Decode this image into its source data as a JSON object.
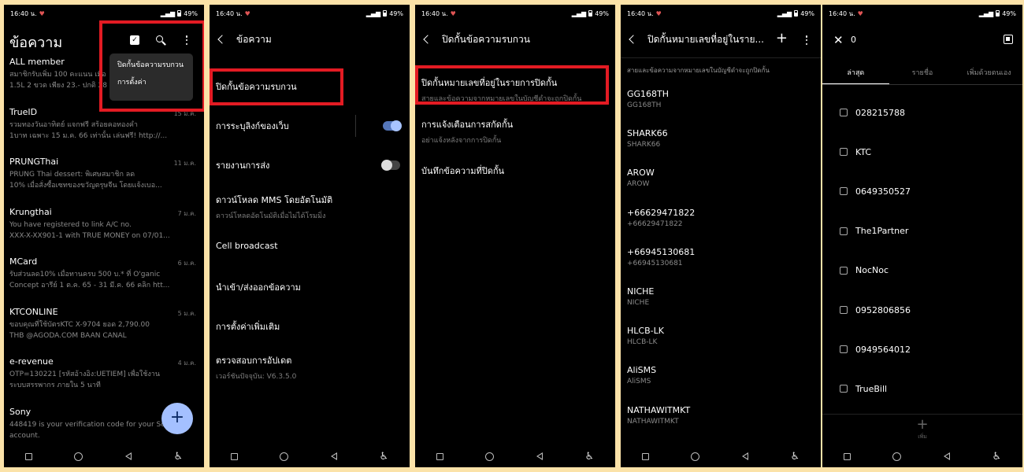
{
  "status": {
    "time": "16:40 น.",
    "battery": "49%"
  },
  "phone1": {
    "title": "ข้อความ",
    "menu": [
      "ปิดกั้นข้อความรบกวน",
      "การตั้งค่า"
    ],
    "messages": [
      {
        "name": "ALL member",
        "date": "",
        "line1": "สมาชิกรับเพิ่ม 100 คะแนน เมื่อ",
        "line2": "1.5L 2 ขวด เพียง 23.- ปกติ 28"
      },
      {
        "name": "TrueID",
        "date": "15 ม.ค.",
        "line1": "รวมทองวันอาทิตย์ แจกฟรี สร้อยคอทองคำ",
        "line2": "1บาท เฉพาะ 15 ม.ค. 66 เท่านั้น เล่นฟรี! http://..."
      },
      {
        "name": "PRUNGThai",
        "date": "11 ม.ค.",
        "line1": "PRUNG Thai dessert: พิเศษสมาชิก ลด",
        "line2": "10% เมื่อสั่งซื้อเซทของขวัญตรุษจีน โดยแจ้งเบอ..."
      },
      {
        "name": "Krungthai",
        "date": "7 ม.ค.",
        "line1": "You have registered to link A/C no.",
        "line2": "XXX-X-XX901-1 with TRUE MONEY on 07/01..."
      },
      {
        "name": "MCard",
        "date": "6 ม.ค.",
        "line1": "รับส่วนลด10% เมื่อทานครบ 500 บ.* ที่ O'ganic",
        "line2": "Concept อารีย์ 1 ต.ค. 65 - 31 มี.ค. 66 คลิก htt..."
      },
      {
        "name": "KTCONLINE",
        "date": "5 ม.ค.",
        "line1": "ขอบคุณที่ใช้บัตรKTC X-9704  ยอด 2,790.00",
        "line2": "THB @AGODA.COM BAAN CANAL"
      },
      {
        "name": "e-revenue",
        "date": "4 ม.ค.",
        "line1": "OTP=130221 [รหัสอ้างอิง:UETIEM] เพื่อใช้งาน",
        "line2": "ระบบสรรพากร ภายใน 5 นาที"
      },
      {
        "name": "Sony",
        "date": "",
        "line1": "448419 is your verification code for your Sony",
        "line2": "account."
      }
    ]
  },
  "phone2": {
    "header": "ข้อความ",
    "items": [
      {
        "title": "ปิดกั้นข้อความรบกวน",
        "sub": ""
      },
      {
        "title": "การระบุลิงก์ของเว็บ",
        "sub": ""
      },
      {
        "title": "รายงานการส่ง",
        "sub": ""
      },
      {
        "title": "ดาวน์โหลด MMS โดยอัตโนมัติ",
        "sub": "ดาวน์โหลดอัตโนมัติเมื่อไม่ได้โรมมิ่ง"
      },
      {
        "title": "Cell broadcast",
        "sub": ""
      },
      {
        "title": "นำเข้า/ส่งออกข้อความ",
        "sub": ""
      },
      {
        "title": "การตั้งค่าเพิ่มเติม",
        "sub": ""
      },
      {
        "title": "ตรวจสอบการอัปเดต",
        "sub": "เวอร์ชันปัจจุบัน: V6.3.5.0"
      }
    ]
  },
  "phone3": {
    "header": "ปิดกั้นข้อความรบกวน",
    "items": [
      {
        "title": "ปิดกั้นหมายเลขที่อยู่ในรายการปิดกั้น",
        "sub": "สายและข้อความจากหมายเลขในบัญชีดำจะถูกปิดกั้น"
      },
      {
        "title": "การแจ้งเตือนการสกัดกั้น",
        "sub": "อย่าแจ้งหลังจากการปิดกั้น"
      },
      {
        "title": "บันทึกข้อความที่ปิดกั้น",
        "sub": ""
      }
    ]
  },
  "phone4": {
    "header": "ปิดกั้นหมายเลขที่อยู่ในราย...",
    "note": "สายและข้อความจากหมายเลขในบัญชีดำจะถูกปิดกั้น",
    "items": [
      {
        "title": "GG168TH",
        "sub": "GG168TH"
      },
      {
        "title": "SHARK66",
        "sub": "SHARK66"
      },
      {
        "title": "AROW",
        "sub": "AROW"
      },
      {
        "title": "+66629471822",
        "sub": "+66629471822"
      },
      {
        "title": "+66945130681",
        "sub": "+66945130681"
      },
      {
        "title": "NICHE",
        "sub": "NICHE"
      },
      {
        "title": "HLCB-LK",
        "sub": "HLCB-LK"
      },
      {
        "title": "AliSMS",
        "sub": "AliSMS"
      },
      {
        "title": "NATHAWITMKT",
        "sub": "NATHAWITMKT"
      }
    ]
  },
  "phone5": {
    "count": "0",
    "tabs": [
      "ล่าสุด",
      "รายชื่อ",
      "เพิ่มด้วยตนเอง"
    ],
    "items": [
      "028215788",
      "KTC",
      "0649350527",
      "The1Partner",
      "NocNoc",
      "0952806856",
      "0949564012",
      "TrueBill"
    ],
    "add_label": "เพิ่ม"
  }
}
